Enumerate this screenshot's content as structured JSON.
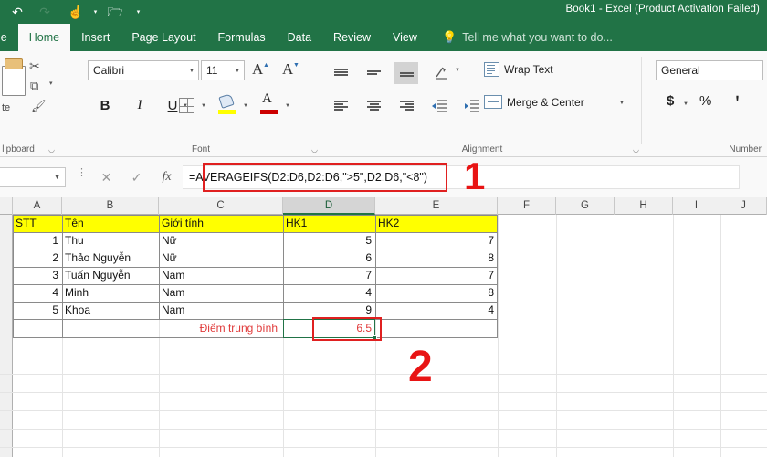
{
  "window": {
    "title": "Book1 - Excel (Product Activation Failed)"
  },
  "quick_access": {
    "undo": "↶",
    "redo": "↷",
    "touch": "☝",
    "open": "🗁",
    "customize": "▾"
  },
  "ribbon_tabs": [
    {
      "label": "le",
      "active": false
    },
    {
      "label": "Home",
      "active": true
    },
    {
      "label": "Insert",
      "active": false
    },
    {
      "label": "Page Layout",
      "active": false
    },
    {
      "label": "Formulas",
      "active": false
    },
    {
      "label": "Data",
      "active": false
    },
    {
      "label": "Review",
      "active": false
    },
    {
      "label": "View",
      "active": false
    }
  ],
  "tell_me": {
    "text": "Tell me what you want to do...",
    "icon": "💡"
  },
  "ribbon": {
    "clipboard": {
      "group_label": "lipboard",
      "paste_label": "te",
      "cut": "✂",
      "copy": "⧉",
      "format_painter": "🖌",
      "more": "▾"
    },
    "font": {
      "group_label": "Font",
      "font_name": "Calibri",
      "font_size": "11",
      "grow_font": "A",
      "shrink_font": "A",
      "bold": "B",
      "italic": "I",
      "underline": "U"
    },
    "alignment": {
      "group_label": "Alignment",
      "wrap_text": "Wrap Text",
      "merge_center": "Merge & Center"
    },
    "number": {
      "group_label": "Number",
      "format": "General",
      "currency": "$",
      "percent": "%",
      "comma": "＇"
    }
  },
  "formula_bar": {
    "name_box": "",
    "cancel": "✕",
    "enter": "✓",
    "function": "fx",
    "formula": "=AVERAGEIFS(D2:D6,D2:D6,\">5\",D2:D6,\"<8\")"
  },
  "annotations": [
    {
      "id": "1",
      "label": "1"
    },
    {
      "id": "2",
      "label": "2"
    }
  ],
  "sheet": {
    "columns": [
      "A",
      "B",
      "C",
      "D",
      "E",
      "F",
      "G",
      "H",
      "I",
      "J"
    ],
    "selected_column": "D",
    "row_numbers": [
      "",
      "",
      "",
      "",
      "",
      "",
      "",
      "",
      "",
      "",
      ""
    ],
    "header_row": {
      "A": "STT",
      "B": "Tên",
      "C": "Giới tính",
      "D": "HK1",
      "E": "HK2"
    },
    "rows": [
      {
        "A": "1",
        "B": "Thu",
        "C": "Nữ",
        "D": "5",
        "E": "7"
      },
      {
        "A": "2",
        "B": "Thảo Nguyễn",
        "C": "Nữ",
        "D": "6",
        "E": "8"
      },
      {
        "A": "3",
        "B": "Tuấn Nguyễn",
        "C": "Nam",
        "D": "7",
        "E": "7"
      },
      {
        "A": "4",
        "B": "Minh",
        "C": "Nam",
        "D": "4",
        "E": "8"
      },
      {
        "A": "5",
        "B": "Khoa",
        "C": "Nam",
        "D": "9",
        "E": "4"
      }
    ],
    "summary_row": {
      "label": "Điểm trung bình",
      "result": "6.5"
    }
  },
  "colors": {
    "excel_green": "#217346",
    "header_yellow": "#ffff00",
    "annotation_red": "#e02020",
    "result_red": "#e03a3a"
  }
}
